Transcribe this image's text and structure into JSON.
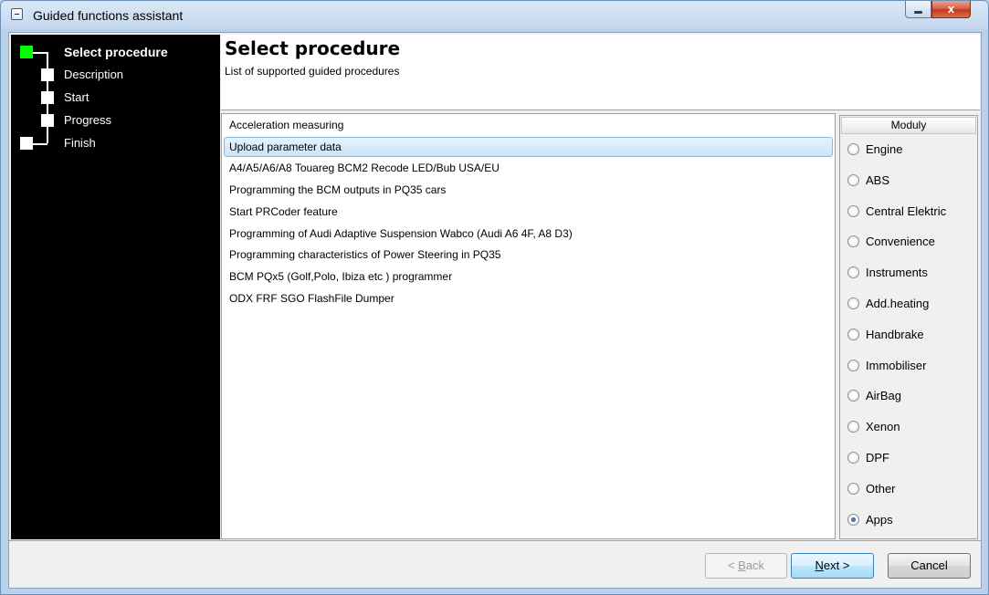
{
  "window": {
    "title": "Guided functions assistant",
    "close_glyph": "x"
  },
  "steps": [
    {
      "label": "Select procedure",
      "active": true
    },
    {
      "label": "Description",
      "active": false
    },
    {
      "label": "Start",
      "active": false
    },
    {
      "label": "Progress",
      "active": false
    },
    {
      "label": "Finish",
      "active": false
    }
  ],
  "header": {
    "title": "Select procedure",
    "subtitle": "List of supported guided procedures"
  },
  "procedures": [
    "Acceleration measuring",
    "Upload parameter data",
    "A4/A5/A6/A8 Touareg BCM2 Recode LED/Bub USA/EU",
    "Programming the BCM outputs in PQ35 cars",
    "Start PRCoder feature",
    "Programming of Audi Adaptive Suspension Wabco (Audi A6 4F, A8 D3)",
    "Programming characteristics of Power Steering in PQ35",
    "BCM PQx5 (Golf,Polo, Ibiza etc ) programmer",
    "ODX FRF SGO FlashFile Dumper"
  ],
  "selected_procedure_index": 1,
  "moduly": {
    "header": "Moduly",
    "options": [
      "Engine",
      "ABS",
      "Central Elektric",
      "Convenience",
      "Instruments",
      "Add.heating",
      "Handbrake",
      "Immobiliser",
      "AirBag",
      "Xenon",
      "DPF",
      "Other",
      "Apps"
    ],
    "selected": "Apps"
  },
  "buttons": {
    "back": {
      "prefix": "< ",
      "accel": "B",
      "rest": "ack"
    },
    "next": {
      "accel": "N",
      "rest": "ext >"
    },
    "cancel": "Cancel"
  }
}
